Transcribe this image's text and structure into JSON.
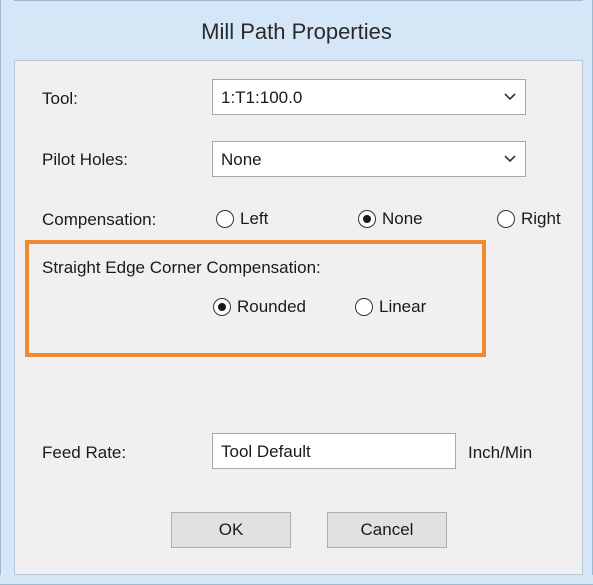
{
  "window": {
    "title": "Mill Path Properties"
  },
  "tool": {
    "label": "Tool:",
    "value": "1:T1:100.0"
  },
  "pilot_holes": {
    "label": "Pilot Holes:",
    "value": "None"
  },
  "compensation": {
    "label": "Compensation:",
    "options": [
      "Left",
      "None",
      "Right"
    ],
    "selected": "None"
  },
  "corner_compensation": {
    "label": "Straight Edge Corner Compensation:",
    "options": [
      "Rounded",
      "Linear"
    ],
    "selected": "Rounded"
  },
  "feed_rate": {
    "label": "Feed Rate:",
    "value": "Tool Default",
    "unit": "Inch/Min"
  },
  "buttons": {
    "ok": "OK",
    "cancel": "Cancel"
  },
  "colors": {
    "highlight": "#ef8a33",
    "titlebar": "#d5e6f7"
  }
}
